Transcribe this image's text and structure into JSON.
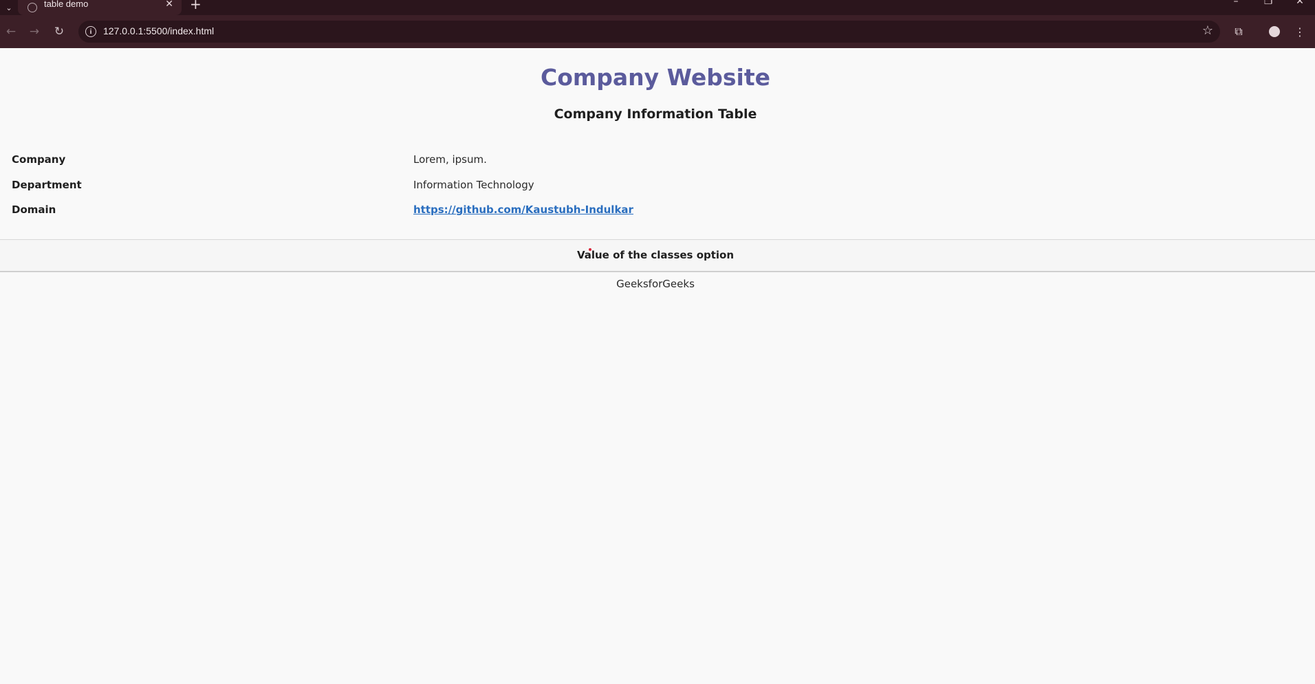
{
  "browser": {
    "tab": {
      "title": "table demo",
      "close_glyph": "✕"
    },
    "new_tab_glyph": "+",
    "url": "127.0.0.1:5500/index.html",
    "icons": {
      "tab_menu": "chevron-down-icon",
      "back": "arrow-left-icon",
      "forward": "arrow-right-icon",
      "reload": "reload-icon",
      "site_info": "info-icon",
      "bookmark": "star-icon",
      "extensions": "puzzle-icon",
      "profile": "person-icon",
      "menu": "kebab-menu-icon"
    },
    "colors": {
      "tabstrip": "#2b151c",
      "toolbar": "#3c1f27"
    }
  },
  "page": {
    "title": "Company Website",
    "caption": "Company Information Table",
    "rows": [
      {
        "label": "Company",
        "value": "Lorem, ipsum."
      },
      {
        "label": "Department",
        "value": "Information Technology"
      },
      {
        "label": "Domain",
        "value": " https://github.com/Kaustubh-Indulkar",
        "is_link": true
      }
    ],
    "footer_bar": "Value of the classes option",
    "credit": "GeeksforGeeks",
    "colors": {
      "title": "#5b5b9c",
      "link": "#2a6ebf",
      "background": "#f9f9f9"
    }
  }
}
